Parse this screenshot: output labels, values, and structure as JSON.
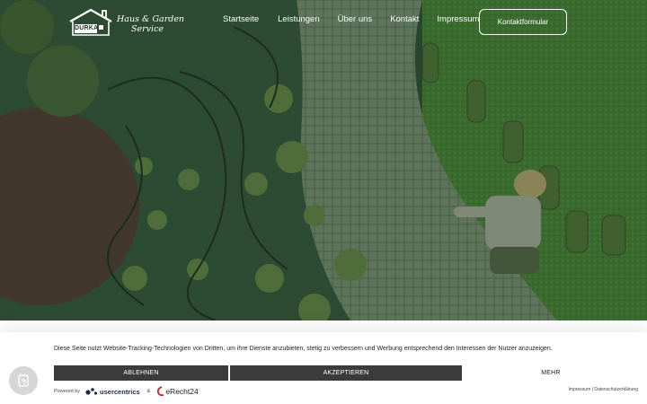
{
  "header": {
    "logo": {
      "box_text": "DURKA",
      "script_line1": "Haus & Garden",
      "script_line2": "Service"
    },
    "nav": [
      {
        "label": "Startseite"
      },
      {
        "label": "Leistungen"
      },
      {
        "label": "Über uns"
      },
      {
        "label": "Kontakt"
      },
      {
        "label": "Impressum"
      }
    ],
    "cta_label": "Kontaktformular"
  },
  "hero": {
    "image": "aerial-garden-landscaping-photo"
  },
  "consent": {
    "message": "Diese Seite nutzt Website-Tracking-Technologien von Dritten, um ihre Dienste anzubieten, stetig zu verbessern und Werbung entsprechend den Interessen der Nutzer anzuzeigen.",
    "deny_label": "ABLEHNEN",
    "accept_label": "AKZEPTIEREN",
    "more_label": "MEHR",
    "powered_by": "Powered by",
    "usercentrics": "usercentrics",
    "ampersand": "&",
    "erecht24": "eRecht24",
    "impressum": "Impressum",
    "separator": "|",
    "datenschutz": "Datenschutzerklärung"
  },
  "colors": {
    "hero_dark_green": "#2e4a30",
    "banner_button": "#3b3b3b",
    "header_text": "#ffffff"
  },
  "icons": {
    "floating_badge": "fingerprint-icon"
  }
}
